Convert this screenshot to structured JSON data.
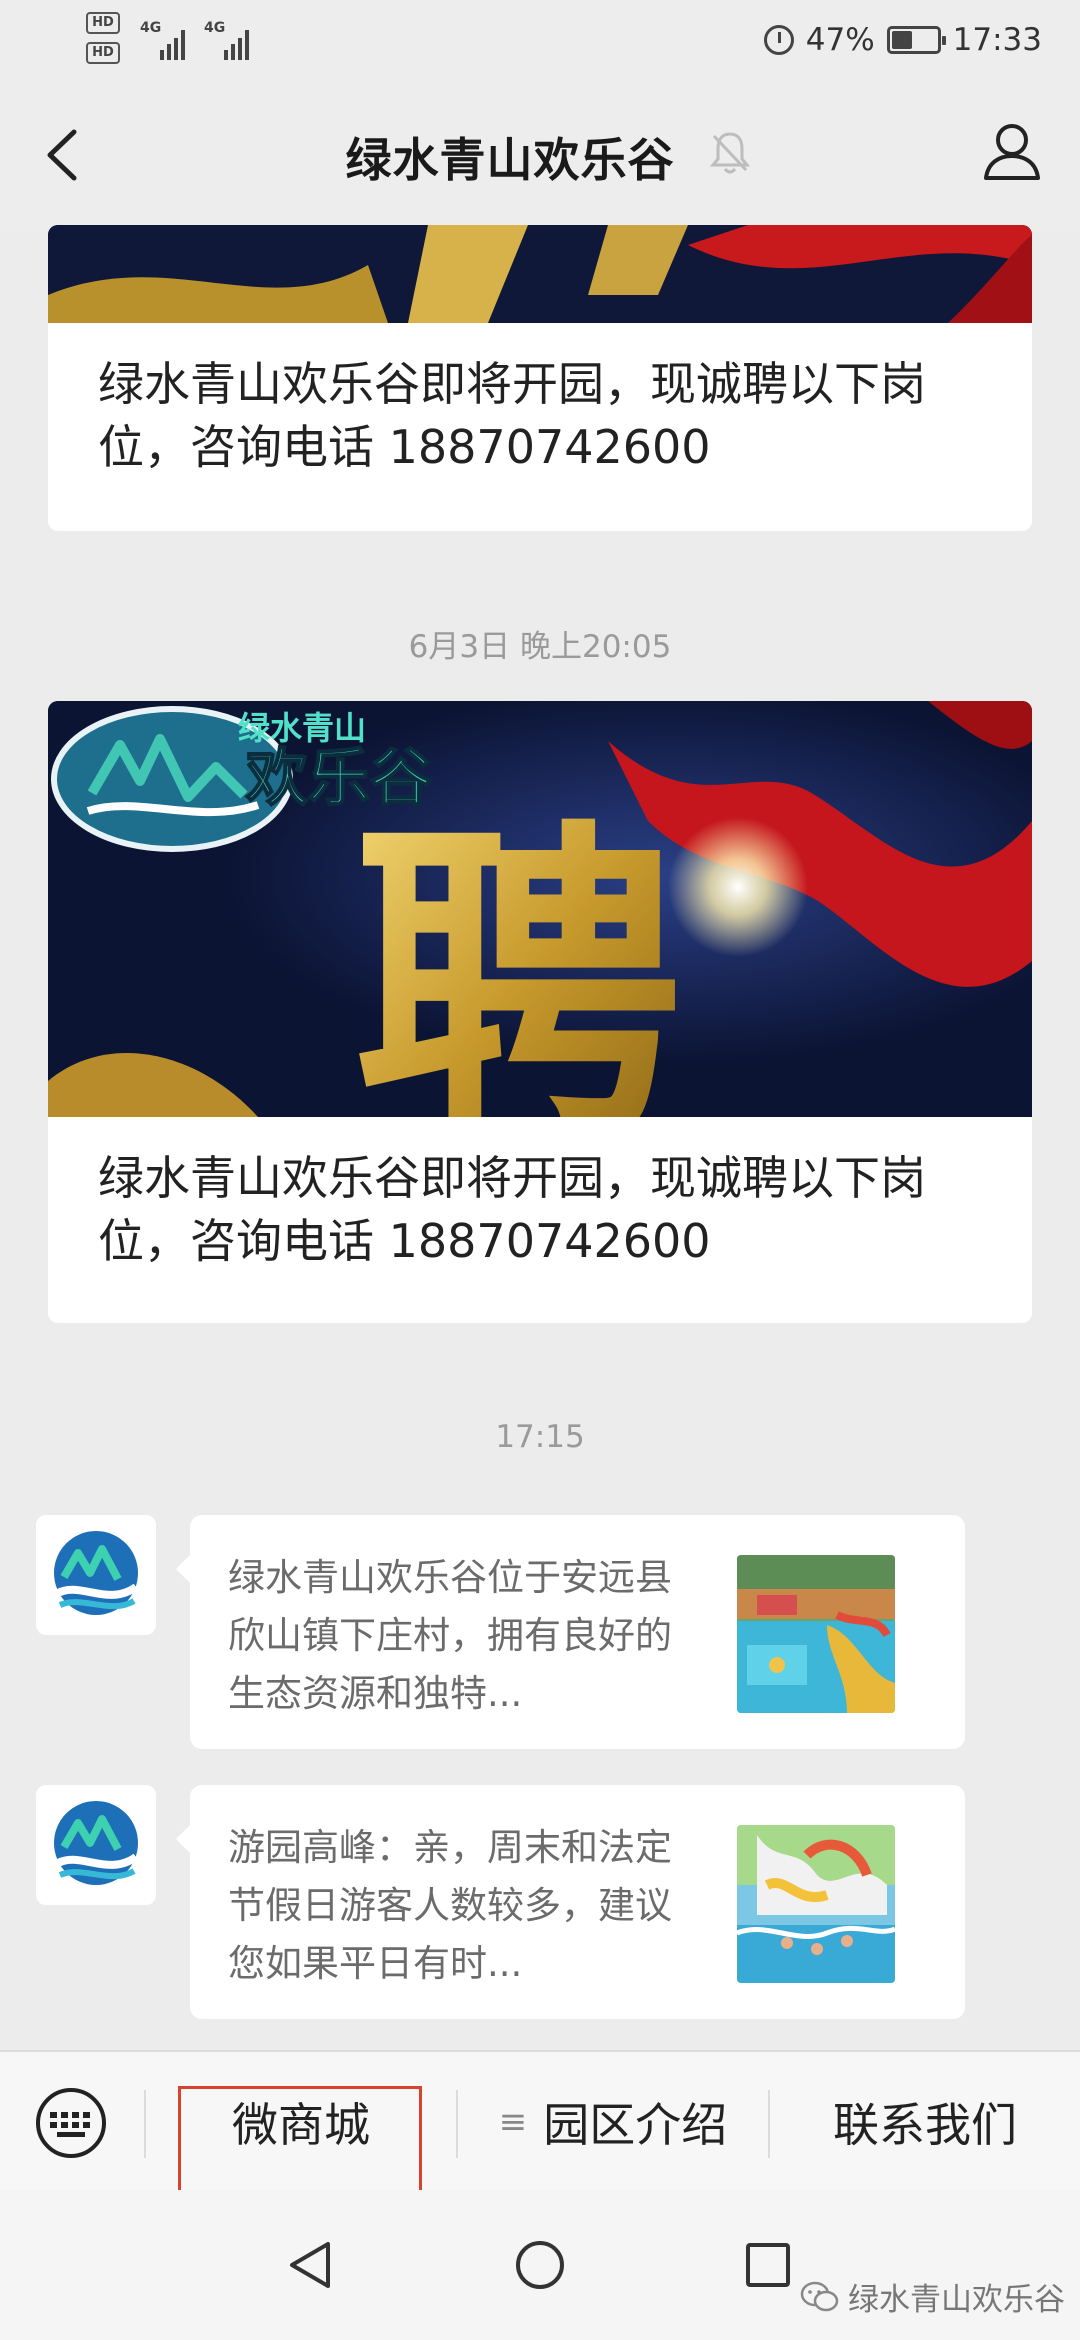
{
  "status_bar": {
    "network_1": "4G",
    "network_2": "4G",
    "hd_1": "HD",
    "hd_2": "HD",
    "battery_text": "47%",
    "battery_level": 0.47,
    "time": "17:33"
  },
  "header": {
    "title": "绿水青山欢乐谷",
    "back_icon": "chevron-left-icon",
    "mute_icon": "bell-muted-icon",
    "profile_icon": "user-icon"
  },
  "messages": {
    "article_1": {
      "text": "绿水青山欢乐谷即将开园，现诚聘以下岗位，咨询电话 18870742600"
    },
    "time_1": "6月3日 晚上20:05",
    "article_2": {
      "banner_logo_small": "绿水青山",
      "banner_logo_big": "欢乐谷",
      "banner_char": "聘",
      "text": "绿水青山欢乐谷即将开园，现诚聘以下岗位，咨询电话 18870742600"
    },
    "time_2": "17:15",
    "link_1": {
      "text": "绿水青山欢乐谷位于安远县欣山镇下庄村，拥有良好的生态资源和独特..."
    },
    "link_2": {
      "text": "游园高峰：亲，周末和法定节假日游客人数较多，建议您如果平日有时..."
    }
  },
  "menu": {
    "keyboard_icon": "keyboard-icon",
    "item_1": "微商城",
    "item_2": "园区介绍",
    "item_2_icon": "≡",
    "item_3": "联系我们"
  },
  "watermark": {
    "text": "绿水青山欢乐谷"
  },
  "colors": {
    "highlight": "#d9432b",
    "banner_bg": "#101a3c",
    "background": "#ececec"
  }
}
